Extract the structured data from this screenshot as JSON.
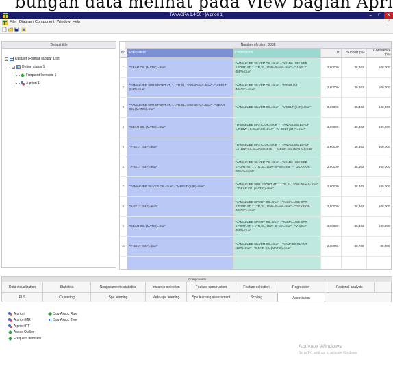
{
  "caption": "bungan data melihat pada View bagian Apriori 1)",
  "window": {
    "title": "TANAGRA 1.4.50 - [A priori 1]",
    "min": "–",
    "max": "□",
    "close": "✕",
    "restore": "_ ♂"
  },
  "menu": [
    "File",
    "Diagram",
    "Component",
    "Window",
    "Help"
  ],
  "colors": {
    "titlebar": "#1b1b70",
    "antecedent_header": "#7a8fd4",
    "antecedent_cell": "#b9c8f4",
    "consequent_header": "#9ad9cf",
    "consequent_cell": "#bfe8de",
    "close_button": "#c8202a"
  },
  "toolbar_icons": [
    "new-icon",
    "open-icon",
    "save-icon",
    "wizard-icon"
  ],
  "left_panel": {
    "header": "Default title",
    "tree": [
      {
        "label": "Dataset (Format Tabular 1.txt)",
        "icon": "dataset-icon"
      },
      {
        "label": "Define status 1",
        "icon": "define-status-icon"
      },
      {
        "label": "Frequent Itemsets 1",
        "icon": "frequent-itemsets-icon"
      },
      {
        "label": "A priori 1",
        "icon": "apriori-icon"
      }
    ]
  },
  "rules": {
    "title": "Number of rules : 8336",
    "columns": {
      "n": "N°",
      "antecedent": "Antecedent",
      "consequent": "Consequent",
      "lift": "Lift",
      "support": "Support (%)",
      "confidence": "Confidence (%)"
    },
    "rows": [
      {
        "n": "1",
        "antecedent": "\"GEAR OIL (MATIC)=true\"",
        "consequent": "\"YAMALUBE SILVER OIL=true\" - \"YAMALUBE SPR SPORT 4T, 1 LTR,SL, 10W-40-MA=true\" - \"V-BELT (54P)=true\"",
        "lift": "2,60000",
        "support": "38,462",
        "confidence": "100,000"
      },
      {
        "n": "2",
        "antecedent": "\"YAMALUBE SPR SPORT 4T, 1 LTR,SL, 10W-40-MA=true\" - \"V-BELT (54P)=true\"",
        "consequent": "\"YAMALUBE SILVER OIL=true\" - \"GEAR OIL (MATIC)=true\"",
        "lift": "2,60000",
        "support": "38,462",
        "confidence": "100,000"
      },
      {
        "n": "3",
        "antecedent": "\"YAMALUBE SPR SPORT 4T, 1 LTR,SL, 10W-40-MA=true\" - \"GEAR OIL (MATIC)=true\"",
        "consequent": "\"YAMALUBE SILVER OIL=true\" - \"V-BELT (54P)=true\"",
        "lift": "2,60000",
        "support": "38,462",
        "confidence": "100,000"
      },
      {
        "n": "4",
        "antecedent": "\"GEAR OIL (MATIC)=true\"",
        "consequent": "\"YAMALUBE MATIC OIL=true\" - \"YAMALUBE BS-GP 1,7,10W-40,SL,JASO=true\" - \"V-BELT (54P)=true\"",
        "lift": "2,60000",
        "support": "38,462",
        "confidence": "100,000"
      },
      {
        "n": "5",
        "antecedent": "\"V-BELT (54P)=true\"",
        "consequent": "\"YAMALUBE MATIC OIL=true\" - \"YAMALUBE BS-GP 1,7,10W-40,SL,JASO=true\" - \"GEAR OIL (MATIC)=true\"",
        "lift": "2,60000",
        "support": "38,462",
        "confidence": "100,000"
      },
      {
        "n": "6",
        "antecedent": "\"V-BELT (54P)=true\"",
        "consequent": "\"YAMALUBE SILVER OIL=true\" - \"YAMALUBE SPR SPORT 4T, 1 LTR,SL, 10W-40-MA=true\" - \"GEAR OIL (MATIC)=true\"",
        "lift": "2,60000",
        "support": "38,462",
        "confidence": "100,000"
      },
      {
        "n": "7",
        "antecedent": "\"YAMALUBE SILVER OIL=true\" - \"V-BELT (54P)=true\"",
        "consequent": "\"YAMALUBE SPR SPORT 4T, 1 LTR,SL, 10W-40-MA=true\" - \"GEAR OIL (MATIC)=true\"",
        "lift": "2,60000",
        "support": "38,462",
        "confidence": "100,000"
      },
      {
        "n": "8",
        "antecedent": "\"V-BELT (54P)=true\"",
        "consequent": "\"YAMALUBE SPORT OIL=true\" - \"YAMALUBE SPR SPORT 4T, 1 LTR,SL, 10W-40-MA=true\" - \"GEAR OIL (MATIC)=true\"",
        "lift": "2,60000",
        "support": "38,462",
        "confidence": "100,000"
      },
      {
        "n": "9",
        "antecedent": "\"GEAR OIL (MATIC)=true\"",
        "consequent": "\"YAMALUBE SPORT OIL=true\" - \"YAMALUBE SPR SPORT 4T, 1 LTR,SL, 10W-40-MA=true\" - \"V-BELT (54P)=true\"",
        "lift": "2,60000",
        "support": "38,462",
        "confidence": "100,000"
      },
      {
        "n": "10",
        "antecedent": "\"V-BELT (54P)=true\"",
        "consequent": "\"YAMALUBE SILVER OIL=true\" - \"YAMACOOLANT (1ST)=true\" - \"GEAR OIL (MATIC)=true\"",
        "lift": "2,60000",
        "support": "30,769",
        "confidence": "80,000"
      }
    ]
  },
  "components": {
    "title": "Components",
    "row1": [
      "Data visualization",
      "Statistics",
      "Nonparametric statistics",
      "Instance selection",
      "Feature construction",
      "Feature selection",
      "Regression",
      "Factorial analysis"
    ],
    "row2": [
      "PLS",
      "Clustering",
      "Spv learning",
      "Meta-spv learning",
      "Spv learning assessment",
      "Scoring",
      "Association"
    ],
    "active": "Association",
    "items_col1": [
      "A priori",
      "A priori MR",
      "A priori PT",
      "Assoc Outlier",
      "Frequent Itemsets"
    ],
    "items_col2": [
      "Spv Assoc Rule",
      "Spv Assoc Tree"
    ]
  },
  "watermark": {
    "line1": "Activate Windows",
    "line2": "Go to PC settings to activate Windows."
  }
}
